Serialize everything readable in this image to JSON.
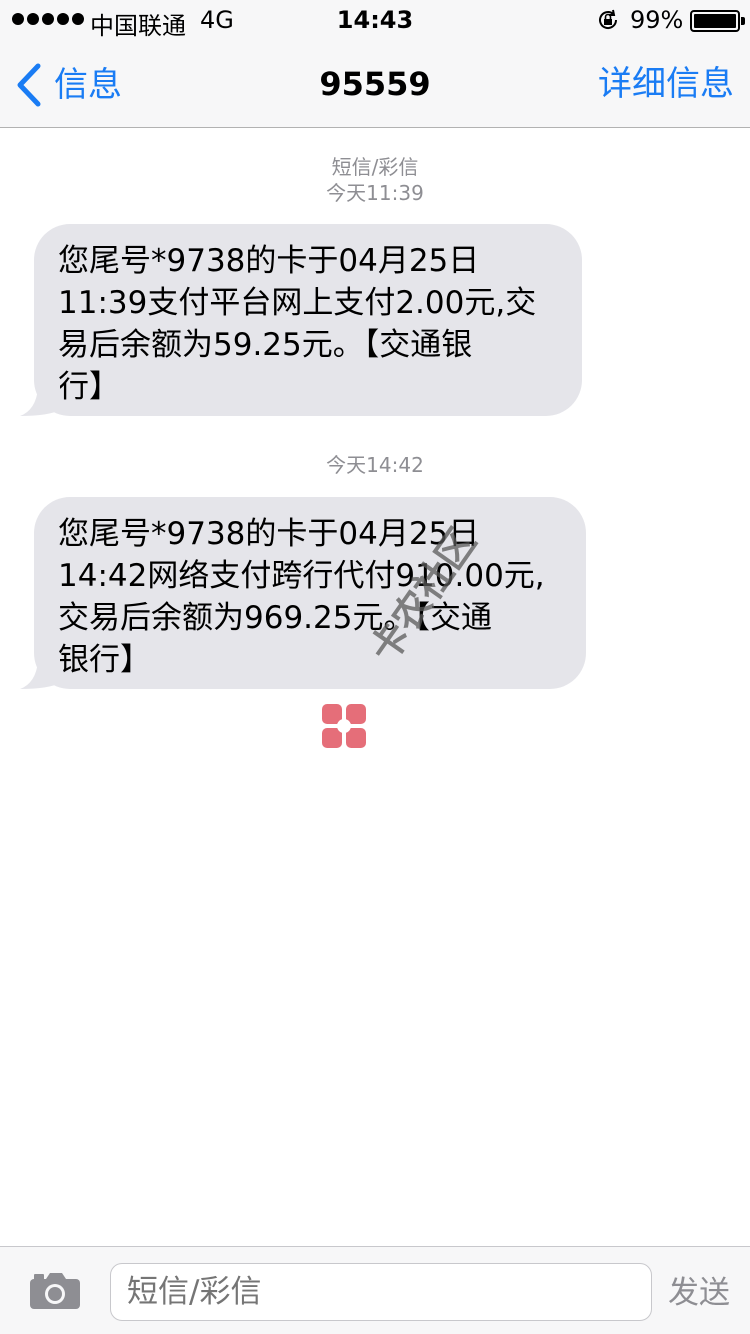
{
  "status_bar": {
    "carrier": "中国联通",
    "network": "4G",
    "time": "14:43",
    "battery": "99%"
  },
  "nav": {
    "back_label": "信息",
    "title": "95559",
    "details_label": "详细信息"
  },
  "conversation": {
    "header_type": "短信/彩信",
    "messages": [
      {
        "timestamp": "今天11:39",
        "lines": [
          "您尾号*9738的卡于04月25日",
          "11:39支付平台网上支付2.00元,交",
          "易后余额为59.25元。【交通银",
          "行】"
        ]
      },
      {
        "timestamp": "今天14:42",
        "lines": [
          "您尾号*9738的卡于04月25日",
          "14:42网络支付跨行代付910.00元,",
          "交易后余额为969.25元。【交通",
          "银行】"
        ]
      }
    ]
  },
  "watermark": {
    "text": "卡农社区"
  },
  "input_bar": {
    "placeholder": "短信/彩信",
    "send_label": "发送"
  },
  "colors": {
    "accent": "#1a7cf4",
    "bubble": "#e5e5ea",
    "meta_text": "#8e8e93"
  },
  "icons": [
    "signal-icon",
    "orientation-lock-icon",
    "battery-icon",
    "back-chevron-icon",
    "camera-icon",
    "watermark-logo-icon"
  ]
}
